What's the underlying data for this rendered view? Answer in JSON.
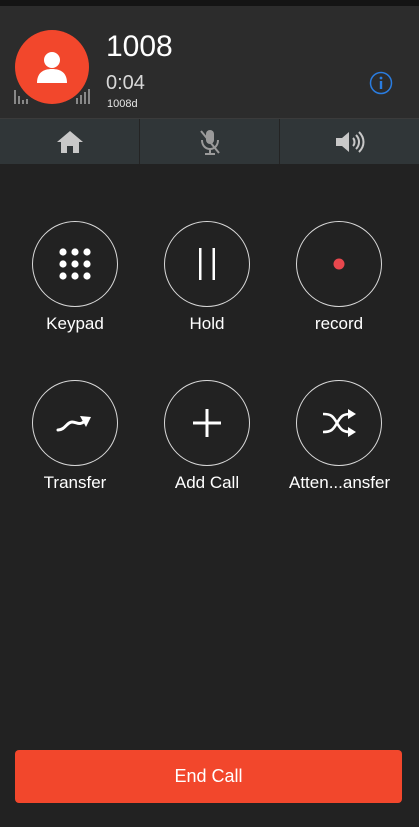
{
  "call": {
    "caller_name": "1008",
    "timer": "0:04",
    "caller_sub": "1008d"
  },
  "icons": {
    "avatar": "person-icon",
    "signal": "signal-bars-icon",
    "info": "info-icon",
    "home": "home-icon",
    "mute": "mic-muted-icon",
    "speaker": "speaker-icon"
  },
  "controls": {
    "keypad": "Keypad",
    "hold": "Hold",
    "record": "record",
    "transfer": "Transfer",
    "add_call": "Add Call",
    "attended_transfer": "Atten...ansfer"
  },
  "end_call": "End Call",
  "colors": {
    "accent": "#f2472c",
    "background": "#222222",
    "header": "#2c2c2c",
    "record_dot": "#e8474d",
    "info_blue": "#2a7de1"
  }
}
